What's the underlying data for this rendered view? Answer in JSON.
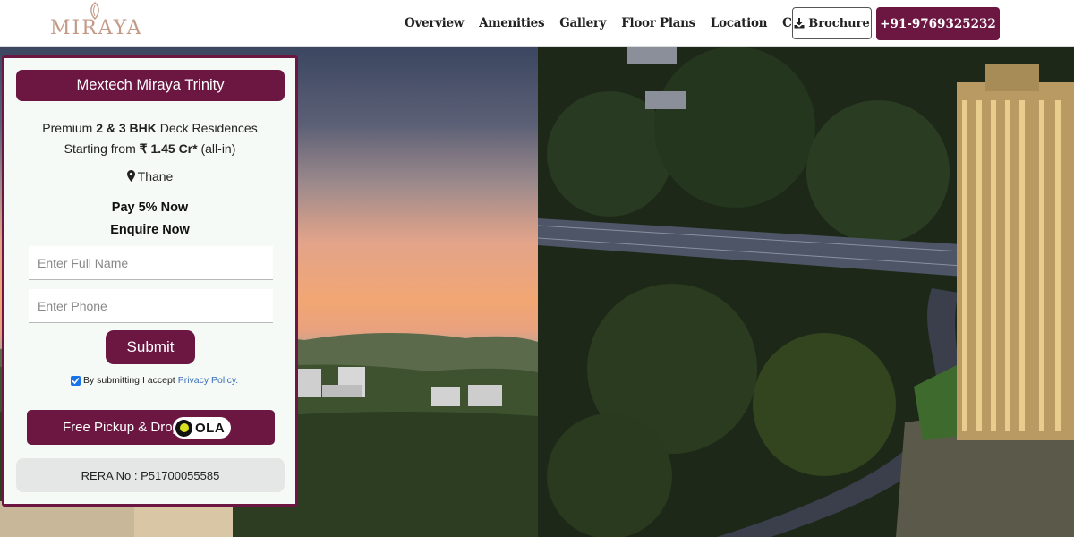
{
  "brand": {
    "logo_text": "MIRAYA"
  },
  "nav": {
    "items": [
      "Overview",
      "Amenities",
      "Gallery",
      "Floor Plans",
      "Location",
      "Contact"
    ],
    "brochure_label": "Brochure",
    "phone_label": "+91-9769325232"
  },
  "colors": {
    "accent": "#6b1741",
    "logo": "#c49a87",
    "link": "#3a6fb8"
  },
  "form": {
    "title": "Mextech Miraya Trinity",
    "line1_prefix": "Premium ",
    "line1_bold": "2 & 3 BHK",
    "line1_suffix": " Deck Residences",
    "line2_prefix": "Starting from ",
    "line2_bold": "₹ 1.45 Cr*",
    "line2_suffix": " (all-in)",
    "location": "Thane",
    "offer": "Pay 5% Now",
    "cta": "Enquire Now",
    "name_placeholder": "Enter Full Name",
    "phone_placeholder": "Enter Phone",
    "submit_label": "Submit",
    "consent_text": "By submitting I accept",
    "consent_link": "Privacy Policy.",
    "consent_checked": true,
    "pickup_label": "Free Pickup & Drop",
    "ola_text": "OLA",
    "rera": "RERA No : P51700055585"
  }
}
